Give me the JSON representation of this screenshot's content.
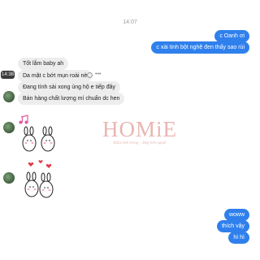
{
  "timestamp": "14:07",
  "messages": {
    "out1": "c Oanh ơi",
    "out2": "c xài tinh bột nghệ đen thấy sao rùi",
    "in1": "Tốt lắm baby ah",
    "in2": "Da mặt c bớt mụn roài nè",
    "in3": "Đang tính sài xong ủng hộ e tiếp đây",
    "in4": "Bán hàng chất lượng mí chuẩn dc hen",
    "out3": "woww",
    "out4": "thích vậy",
    "out5": "hì hì"
  },
  "hover_time": "14:38",
  "watermark": {
    "title": "HOMiE",
    "subtitle": "Khỏe bên trong – Đẹp bên ngoài"
  },
  "icons": {
    "emoji": "smiley-icon",
    "more": "more-dots-icon",
    "music": "music-note-icon",
    "heart": "heart-icon"
  },
  "colors": {
    "outgoing": "#2f80ed",
    "incoming": "#ededed",
    "watermark": "#e8b6b2"
  }
}
